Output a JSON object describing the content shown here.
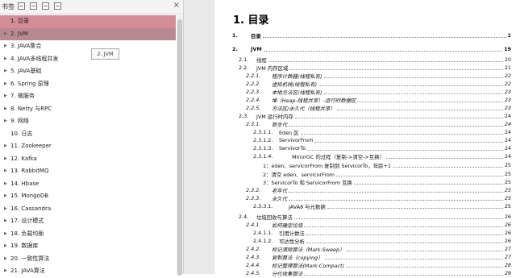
{
  "sidebar": {
    "title": "书签",
    "items": [
      {
        "label": "1. 目录",
        "arrow": ""
      },
      {
        "label": "2. JVM",
        "arrow": "▶"
      },
      {
        "label": "3. JAVA集合",
        "arrow": "▶"
      },
      {
        "label": "4. JAVA多线程并发",
        "arrow": "▶"
      },
      {
        "label": "5. JAVA基础",
        "arrow": "▶"
      },
      {
        "label": "6. Spring 原理",
        "arrow": "▶"
      },
      {
        "label": "7.  微服务",
        "arrow": "▶"
      },
      {
        "label": "8. Netty 与RPC",
        "arrow": "▶"
      },
      {
        "label": "9. 网络",
        "arrow": "▶"
      },
      {
        "label": "10. 日志",
        "arrow": ""
      },
      {
        "label": "11. Zookeeper",
        "arrow": "▶"
      },
      {
        "label": "12. Kafka",
        "arrow": "▶"
      },
      {
        "label": "13. RabbitMQ",
        "arrow": "▶"
      },
      {
        "label": "14. Hbase",
        "arrow": "▶"
      },
      {
        "label": "15. MongoDB",
        "arrow": "▶"
      },
      {
        "label": "16. Cassandra",
        "arrow": "▶"
      },
      {
        "label": "17. 设计模式",
        "arrow": "▶"
      },
      {
        "label": "18. 负载均衡",
        "arrow": "▶"
      },
      {
        "label": "19. 数据库",
        "arrow": "▶"
      },
      {
        "label": "20. 一致性算法",
        "arrow": "▶"
      },
      {
        "label": "21. JAVA算法",
        "arrow": "▶"
      }
    ],
    "tooltip": "2. JVM"
  },
  "doc": {
    "title": "1. 目录",
    "toc": [
      {
        "num": "1.",
        "text": "目录",
        "page": "1",
        "style": "b"
      },
      {
        "num": "2.",
        "text": "JVM",
        "page": "19",
        "style": "b"
      },
      {
        "num": "2.1.",
        "text": "线程",
        "page": "20",
        "style": ""
      },
      {
        "num": "2.2.",
        "text": "JVM 内存区域",
        "page": "21",
        "style": ""
      },
      {
        "num": "2.2.1.",
        "text": "程序计数器(线程私有)",
        "page": "22",
        "style": "i"
      },
      {
        "num": "2.2.2.",
        "text": "虚拟机栈(线程私有)",
        "page": "22",
        "style": "i"
      },
      {
        "num": "2.2.3.",
        "text": "本地方法区(线程私有)",
        "page": "23",
        "style": "i"
      },
      {
        "num": "2.2.4.",
        "text": "堆（Heap-线程共享）-运行时数据区",
        "page": "23",
        "style": "i"
      },
      {
        "num": "2.2.5.",
        "text": "方法区/永久代（线程共享）",
        "page": "23",
        "style": "i"
      },
      {
        "num": "2.3.",
        "text": "JVM 运行时内存",
        "page": "24",
        "style": ""
      },
      {
        "num": "2.3.1.",
        "text": "新生代",
        "page": "24",
        "style": "i"
      },
      {
        "num": "2.3.1.1.",
        "text": "Eden 区",
        "page": "24",
        "style": ""
      },
      {
        "num": "2.3.1.2.",
        "text": "ServivorFrom",
        "page": "24",
        "style": ""
      },
      {
        "num": "2.3.1.3.",
        "text": "ServivorTo",
        "page": "24",
        "style": ""
      },
      {
        "num": "2.3.1.4.",
        "text": "MinorGC 的过程（复制->清空->互换）",
        "page": "24",
        "style": ""
      },
      {
        "num": "",
        "text": "1：eden、servicorFrom 复制到 ServicorTo，年龄+1",
        "page": "25",
        "style": ""
      },
      {
        "num": "",
        "text": "2：清空 eden、servicorFrom",
        "page": "25",
        "style": ""
      },
      {
        "num": "",
        "text": "3：ServicorTo 和 ServicorFrom 互换",
        "page": "25",
        "style": ""
      },
      {
        "num": "2.3.2.",
        "text": "老年代",
        "page": "25",
        "style": "i"
      },
      {
        "num": "2.3.3.",
        "text": "永久代",
        "page": "25",
        "style": "i"
      },
      {
        "num": "2.3.3.1.",
        "text": "JAVA8 与元数据",
        "page": "25",
        "style": ""
      },
      {
        "num": "2.4.",
        "text": "垃圾回收与算法",
        "page": "26",
        "style": ""
      },
      {
        "num": "2.4.1.",
        "text": "如何确定垃圾",
        "page": "26",
        "style": "i"
      },
      {
        "num": "2.4.1.1.",
        "text": "引用计数法",
        "page": "26",
        "style": ""
      },
      {
        "num": "2.4.1.2.",
        "text": "可达性分析",
        "page": "26",
        "style": ""
      },
      {
        "num": "2.4.2.",
        "text": "标记清除算法（Mark-Sweep）",
        "page": "27",
        "style": "i"
      },
      {
        "num": "2.4.3.",
        "text": "复制算法（copying）",
        "page": "27",
        "style": "i"
      },
      {
        "num": "2.4.4.",
        "text": "标记整理算法(Mark-Compact)",
        "page": "28",
        "style": "i"
      },
      {
        "num": "2.4.5.",
        "text": "分代收集算法",
        "page": "29",
        "style": "i"
      }
    ]
  }
}
